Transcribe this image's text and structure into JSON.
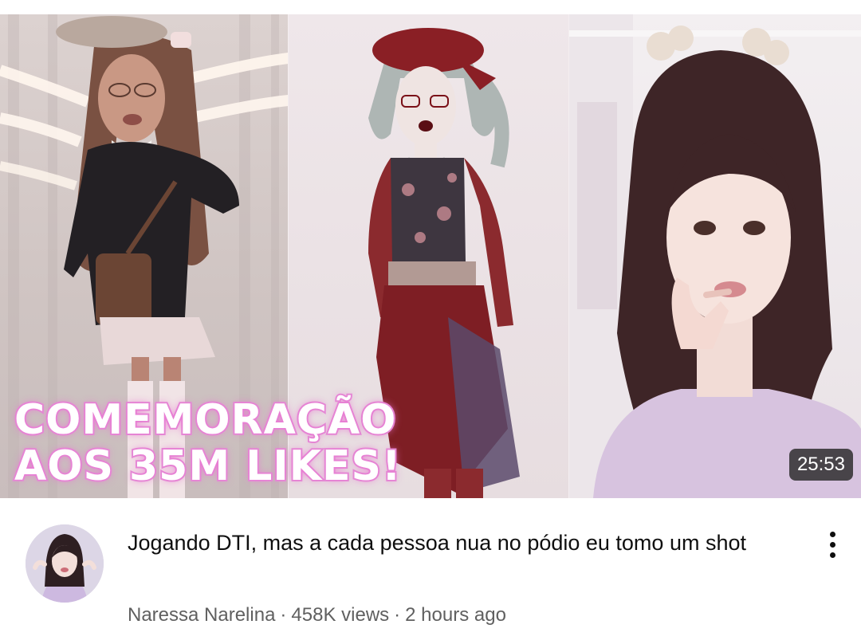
{
  "thumbnail": {
    "overlay_line1": "COMEMORAÇÃO",
    "overlay_line2": "AOS 35M LIKES!",
    "duration": "25:53",
    "accent_color": "#e58bd6"
  },
  "video": {
    "title": "Jogando DTI, mas a cada pessoa nua no pódio eu tomo um shot",
    "channel": "Naressa Narelina",
    "views": "458K views",
    "age": "2 hours ago",
    "separator": "·"
  },
  "icons": {
    "more": "more-vertical-icon"
  }
}
